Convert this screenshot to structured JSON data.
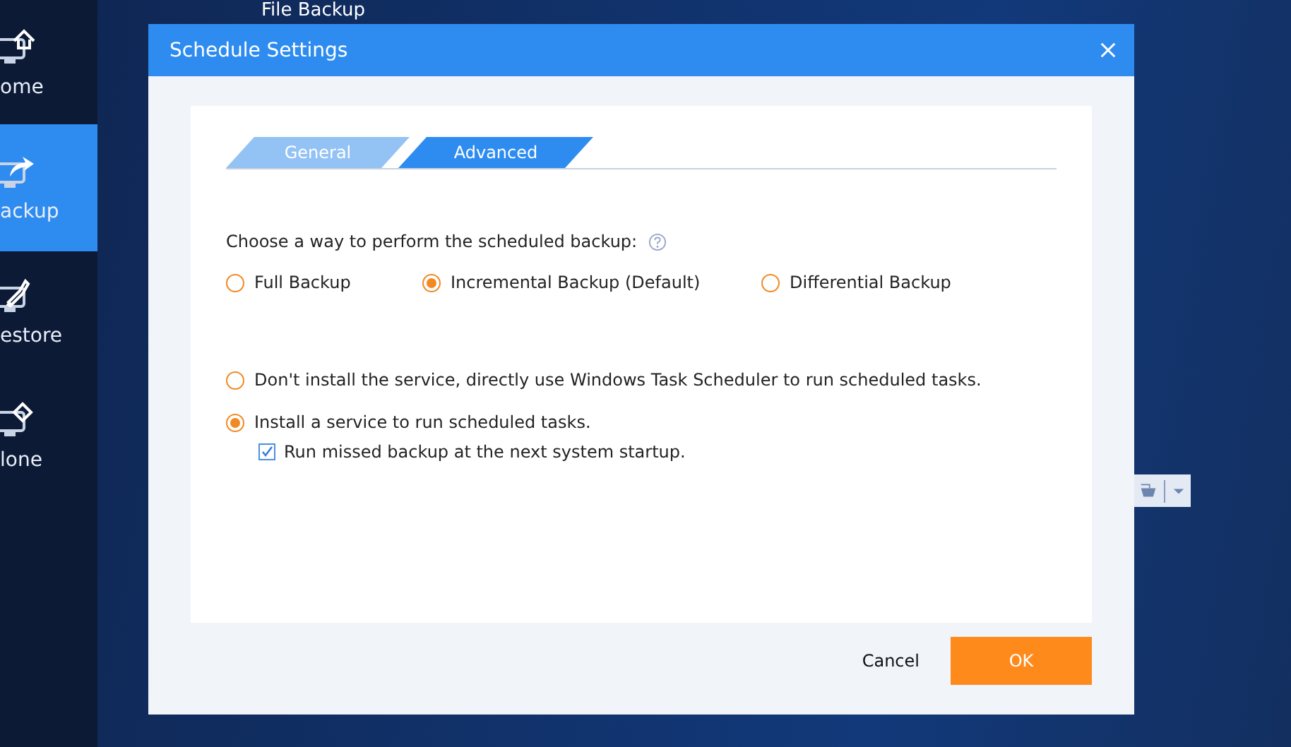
{
  "sidebar": {
    "items": [
      {
        "label": "ome",
        "selected": false,
        "kind": "home"
      },
      {
        "label": "ackup",
        "selected": true,
        "kind": "backup"
      },
      {
        "label": "estore",
        "selected": false,
        "kind": "restore"
      },
      {
        "label": "lone",
        "selected": false,
        "kind": "clone"
      }
    ]
  },
  "page_title": "File Backup",
  "dialog": {
    "title": "Schedule Settings",
    "tabs": [
      {
        "label": "General",
        "selected": false
      },
      {
        "label": "Advanced",
        "selected": true
      }
    ],
    "prompt": "Choose a way to perform the scheduled backup:",
    "backup_types": [
      {
        "label": "Full Backup",
        "selected": false
      },
      {
        "label": "Incremental Backup (Default)",
        "selected": true
      },
      {
        "label": "Differential Backup",
        "selected": false
      }
    ],
    "service_options": [
      {
        "label": "Don't install the service, directly use Windows Task Scheduler to run scheduled tasks.",
        "selected": false
      },
      {
        "label": "Install a service to run scheduled tasks.",
        "selected": true
      }
    ],
    "missed_backup": {
      "label": "Run missed backup at the next system startup.",
      "checked": true
    },
    "buttons": [
      {
        "label": "Cancel",
        "kind": "secondary"
      },
      {
        "label": "OK",
        "kind": "primary"
      }
    ]
  }
}
